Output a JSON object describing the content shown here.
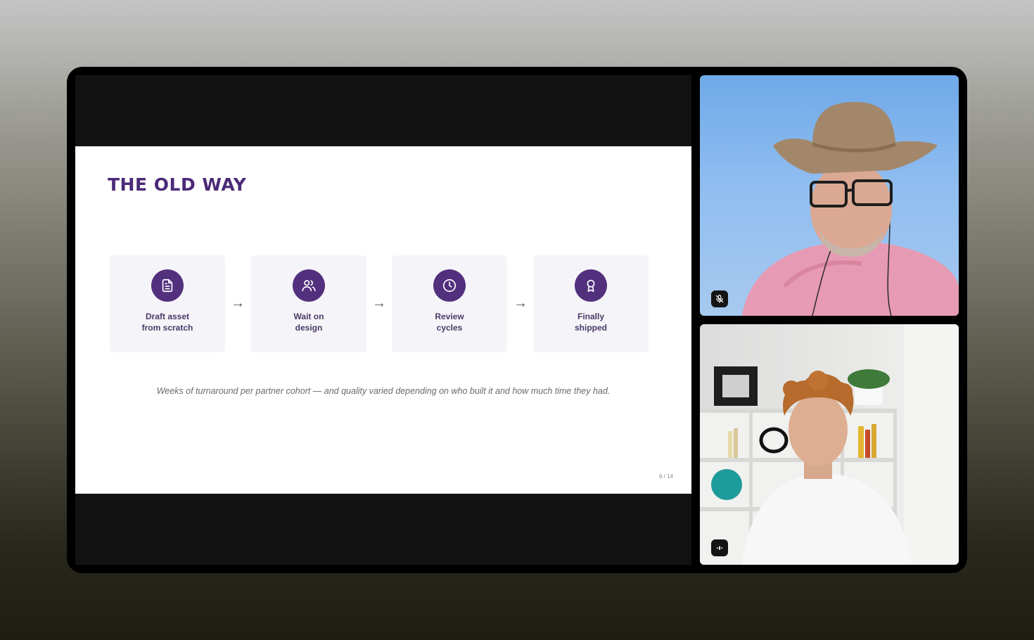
{
  "slide": {
    "title": "THE OLD WAY",
    "steps": [
      {
        "label": "Draft asset\nfrom scratch",
        "icon": "document-icon"
      },
      {
        "label": "Wait on\ndesign",
        "icon": "users-icon"
      },
      {
        "label": "Review\ncycles",
        "icon": "clock-icon"
      },
      {
        "label": "Finally\nshipped",
        "icon": "award-icon"
      }
    ],
    "arrow": "→",
    "caption": "Weeks of turnaround per partner cohort — and quality varied depending on who built it and how much time they had.",
    "page_indicator": "6 / 14"
  },
  "participants": [
    {
      "tile": "participant-hat-man",
      "badge_icon": "mic-muted-icon"
    },
    {
      "tile": "participant-curly-hair",
      "badge_icon": "audio-level-icon"
    }
  ],
  "colors": {
    "accent": "#53307e",
    "title": "#4b2a78",
    "step_bg": "#f5f4f8"
  }
}
